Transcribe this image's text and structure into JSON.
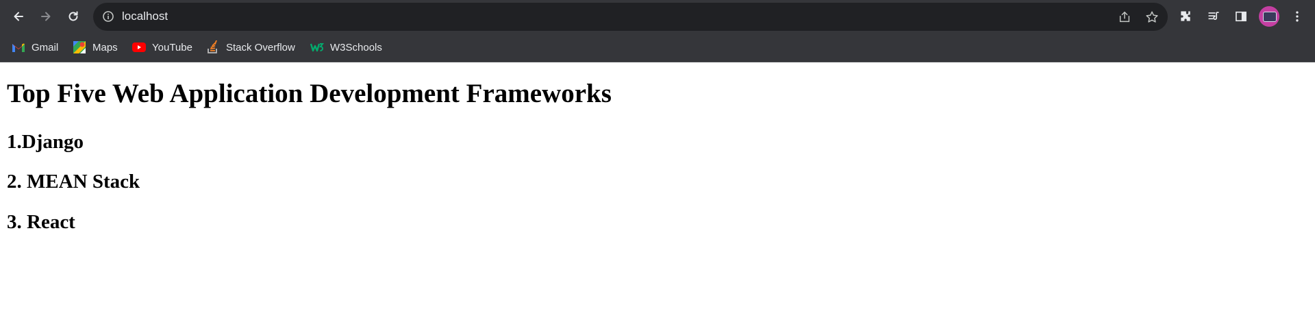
{
  "browser": {
    "url": "localhost",
    "bookmarks": [
      {
        "label": "Gmail",
        "icon": "gmail-icon"
      },
      {
        "label": "Maps",
        "icon": "maps-icon"
      },
      {
        "label": "YouTube",
        "icon": "youtube-icon"
      },
      {
        "label": "Stack Overflow",
        "icon": "stackoverflow-icon"
      },
      {
        "label": "W3Schools",
        "icon": "w3schools-icon"
      }
    ],
    "colors": {
      "toolbar_bg": "#35363a",
      "omnibox_bg": "#202124",
      "text": "#e8eaed",
      "avatar": "#c43fa2"
    }
  },
  "page": {
    "heading": "Top Five Web Application Development Frameworks",
    "items": [
      "1.Django",
      "2. MEAN Stack",
      "3. React"
    ]
  }
}
